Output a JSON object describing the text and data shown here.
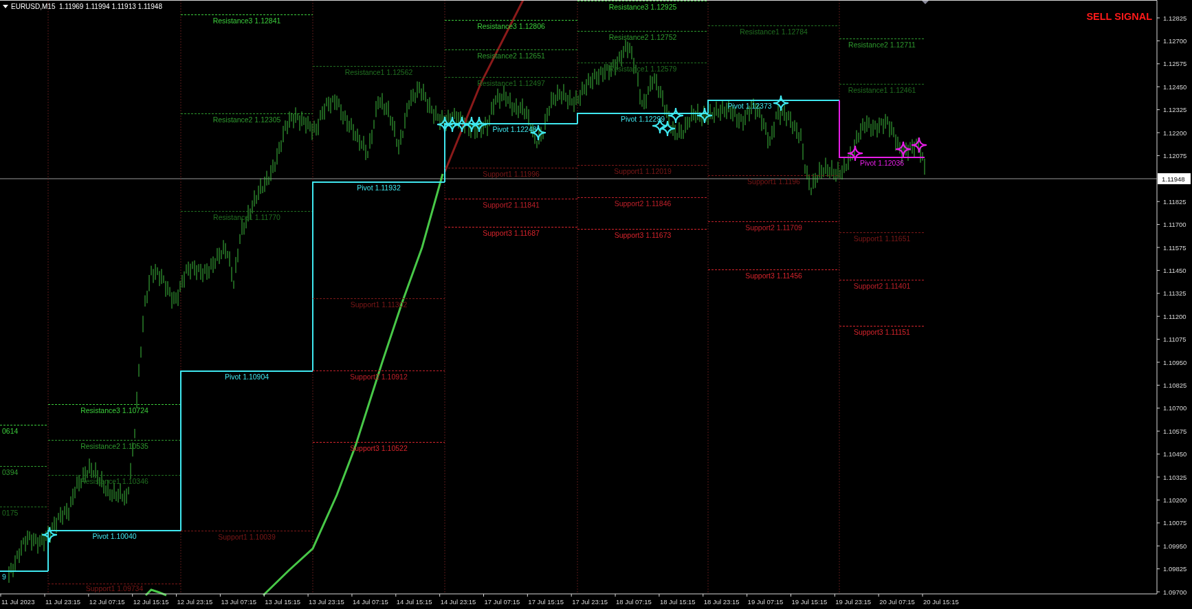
{
  "chart": {
    "title": "EURUSD,M15  1.11969 1.11994 1.11913 1.11948",
    "signal": "SELL SIGNAL",
    "price_axis": [
      "1.12825",
      "1.12700",
      "1.12575",
      "1.12450",
      "1.12325",
      "1.12200",
      "1.12075",
      "1.11825",
      "1.11700",
      "1.11575",
      "1.11450",
      "1.11325",
      "1.11200",
      "1.11075",
      "1.10950",
      "1.10825",
      "1.10700",
      "1.10575",
      "1.10450",
      "1.10325",
      "1.10200",
      "1.10075",
      "1.09950",
      "1.09825",
      "1.09700"
    ],
    "current_price": "1.11948",
    "time_axis": [
      "11 Jul 2023",
      "11 Jul 23:15",
      "12 Jul 07:15",
      "12 Jul 15:15",
      "12 Jul 23:15",
      "13 Jul 07:15",
      "13 Jul 15:15",
      "13 Jul 23:15",
      "14 Jul 07:15",
      "14 Jul 15:15",
      "14 Jul 23:15",
      "17 Jul 07:15",
      "17 Jul 15:15",
      "17 Jul 23:15",
      "18 Jul 07:15",
      "18 Jul 15:15",
      "18 Jul 23:15",
      "19 Jul 07:15",
      "19 Jul 15:15",
      "19 Jul 23:15",
      "20 Jul 07:15",
      "20 Jul 15:15"
    ],
    "periods": [
      {
        "levels": [
          {
            "kind": "resistance",
            "label": "0614",
            "color": "#3ccf3c"
          },
          {
            "kind": "resistance",
            "label": "0394",
            "color": "#2e9a2e"
          },
          {
            "kind": "resistance",
            "label": "0175",
            "color": "#206f20"
          },
          {
            "kind": "pivot",
            "label": "9",
            "color": "#40e8f0"
          }
        ]
      },
      {
        "levels": [
          {
            "kind": "resistance",
            "label": "Resistance3 1.10724",
            "color": "#3ccf3c"
          },
          {
            "kind": "resistance",
            "label": "Resistance2 1.10535",
            "color": "#2e9a2e"
          },
          {
            "kind": "resistance",
            "label": "Resistance1 1.10346",
            "color": "#206f20"
          },
          {
            "kind": "pivot",
            "label": "Pivot 1.10040",
            "color": "#40e8f0"
          },
          {
            "kind": "support",
            "label": "Support1 1.09734",
            "color": "#7d1818"
          }
        ]
      },
      {
        "levels": [
          {
            "kind": "resistance",
            "label": "Resistance3 1.12841",
            "color": "#3ccf3c"
          },
          {
            "kind": "resistance",
            "label": "Resistance2 1.12305",
            "color": "#2e9a2e"
          },
          {
            "kind": "resistance",
            "label": "Resistance1 1.11770",
            "color": "#206f20"
          },
          {
            "kind": "pivot",
            "label": "Pivot 1.10904",
            "color": "#40e8f0"
          },
          {
            "kind": "support",
            "label": "Support1 1.10039",
            "color": "#7d1818"
          }
        ]
      },
      {
        "levels": [
          {
            "kind": "resistance",
            "label": "Resistance1 1.12562",
            "color": "#206f20"
          },
          {
            "kind": "pivot",
            "label": "Pivot 1.11932",
            "color": "#40e8f0"
          },
          {
            "kind": "support",
            "label": "Support1 1.11302",
            "color": "#7d1818"
          },
          {
            "kind": "support",
            "label": "Support2 1.10912",
            "color": "#c0202a"
          },
          {
            "kind": "support",
            "label": "Support3 1.10522",
            "color": "#d8242c"
          }
        ]
      },
      {
        "levels": [
          {
            "kind": "resistance",
            "label": "Resistance3 1.12806",
            "color": "#3ccf3c"
          },
          {
            "kind": "resistance",
            "label": "Resistance2 1.12651",
            "color": "#2e9a2e"
          },
          {
            "kind": "resistance",
            "label": "Resistance1 1.12497",
            "color": "#206f20"
          },
          {
            "kind": "pivot",
            "label": "Pivot 1.12248",
            "color": "#40e8f0"
          },
          {
            "kind": "support",
            "label": "Support1 1.11996",
            "color": "#7d1818"
          },
          {
            "kind": "support",
            "label": "Support2 1.11841",
            "color": "#c0202a"
          },
          {
            "kind": "support",
            "label": "Support3 1.11687",
            "color": "#d8242c"
          }
        ]
      },
      {
        "levels": [
          {
            "kind": "resistance",
            "label": "Resistance3 1.12925",
            "color": "#3ccf3c"
          },
          {
            "kind": "resistance",
            "label": "Resistance2 1.12752",
            "color": "#2e9a2e"
          },
          {
            "kind": "resistance",
            "label": "Resistance1 1.12579",
            "color": "#206f20"
          },
          {
            "kind": "pivot",
            "label": "Pivot 1.12299",
            "color": "#40e8f0"
          },
          {
            "kind": "support",
            "label": "Support1 1.12019",
            "color": "#7d1818"
          },
          {
            "kind": "support",
            "label": "Support2 1.11846",
            "color": "#c0202a"
          },
          {
            "kind": "support",
            "label": "Support3 1.11673",
            "color": "#d8242c"
          }
        ]
      },
      {
        "levels": [
          {
            "kind": "resistance",
            "label": "Resistance1 1.12784",
            "color": "#206f20"
          },
          {
            "kind": "pivot",
            "label": "Pivot 1.12373",
            "color": "#40e8f0"
          },
          {
            "kind": "support",
            "label": "Support1 1.1196",
            "color": "#7d1818"
          },
          {
            "kind": "support",
            "label": "Support2 1.11709",
            "color": "#c0202a"
          },
          {
            "kind": "support",
            "label": "Support3 1.11456",
            "color": "#d8242c"
          }
        ]
      },
      {
        "levels": [
          {
            "kind": "resistance",
            "label": "Resistance2 1.12711",
            "color": "#2e9a2e"
          },
          {
            "kind": "resistance",
            "label": "Resistance1 1.12461",
            "color": "#206f20"
          },
          {
            "kind": "pivot",
            "label": "Pivot 1.12036",
            "color": "#e81ee8"
          },
          {
            "kind": "support",
            "label": "Support1 1.11651",
            "color": "#7d1818"
          },
          {
            "kind": "support",
            "label": "Support2 1.11401",
            "color": "#c0202a"
          },
          {
            "kind": "support",
            "label": "Support3 1.11151",
            "color": "#d8242c"
          }
        ]
      }
    ],
    "markers": [
      {
        "color": "#40e8f0"
      },
      {
        "color": "#40e8f0"
      },
      {
        "color": "#40e8f0"
      },
      {
        "color": "#40e8f0"
      },
      {
        "color": "#40e8f0"
      },
      {
        "color": "#40e8f0"
      },
      {
        "color": "#40e8f0"
      },
      {
        "color": "#40e8f0"
      },
      {
        "color": "#40e8f0"
      },
      {
        "color": "#40e8f0"
      },
      {
        "color": "#40e8f0"
      },
      {
        "color": "#40e8f0"
      },
      {
        "color": "#e81ee8"
      },
      {
        "color": "#e81ee8"
      },
      {
        "color": "#e81ee8"
      }
    ]
  }
}
